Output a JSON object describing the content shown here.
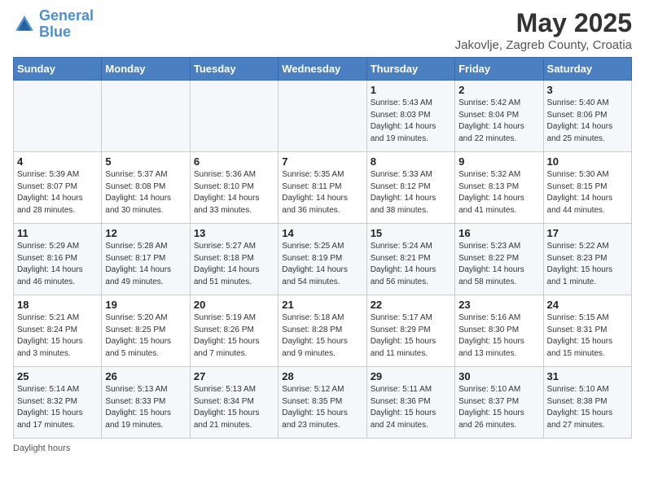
{
  "header": {
    "logo_line1": "General",
    "logo_line2": "Blue",
    "title": "May 2025",
    "subtitle": "Jakovlje, Zagreb County, Croatia"
  },
  "days_of_week": [
    "Sunday",
    "Monday",
    "Tuesday",
    "Wednesday",
    "Thursday",
    "Friday",
    "Saturday"
  ],
  "weeks": [
    [
      {
        "day": "",
        "detail": ""
      },
      {
        "day": "",
        "detail": ""
      },
      {
        "day": "",
        "detail": ""
      },
      {
        "day": "",
        "detail": ""
      },
      {
        "day": "1",
        "detail": "Sunrise: 5:43 AM\nSunset: 8:03 PM\nDaylight: 14 hours\nand 19 minutes."
      },
      {
        "day": "2",
        "detail": "Sunrise: 5:42 AM\nSunset: 8:04 PM\nDaylight: 14 hours\nand 22 minutes."
      },
      {
        "day": "3",
        "detail": "Sunrise: 5:40 AM\nSunset: 8:06 PM\nDaylight: 14 hours\nand 25 minutes."
      }
    ],
    [
      {
        "day": "4",
        "detail": "Sunrise: 5:39 AM\nSunset: 8:07 PM\nDaylight: 14 hours\nand 28 minutes."
      },
      {
        "day": "5",
        "detail": "Sunrise: 5:37 AM\nSunset: 8:08 PM\nDaylight: 14 hours\nand 30 minutes."
      },
      {
        "day": "6",
        "detail": "Sunrise: 5:36 AM\nSunset: 8:10 PM\nDaylight: 14 hours\nand 33 minutes."
      },
      {
        "day": "7",
        "detail": "Sunrise: 5:35 AM\nSunset: 8:11 PM\nDaylight: 14 hours\nand 36 minutes."
      },
      {
        "day": "8",
        "detail": "Sunrise: 5:33 AM\nSunset: 8:12 PM\nDaylight: 14 hours\nand 38 minutes."
      },
      {
        "day": "9",
        "detail": "Sunrise: 5:32 AM\nSunset: 8:13 PM\nDaylight: 14 hours\nand 41 minutes."
      },
      {
        "day": "10",
        "detail": "Sunrise: 5:30 AM\nSunset: 8:15 PM\nDaylight: 14 hours\nand 44 minutes."
      }
    ],
    [
      {
        "day": "11",
        "detail": "Sunrise: 5:29 AM\nSunset: 8:16 PM\nDaylight: 14 hours\nand 46 minutes."
      },
      {
        "day": "12",
        "detail": "Sunrise: 5:28 AM\nSunset: 8:17 PM\nDaylight: 14 hours\nand 49 minutes."
      },
      {
        "day": "13",
        "detail": "Sunrise: 5:27 AM\nSunset: 8:18 PM\nDaylight: 14 hours\nand 51 minutes."
      },
      {
        "day": "14",
        "detail": "Sunrise: 5:25 AM\nSunset: 8:19 PM\nDaylight: 14 hours\nand 54 minutes."
      },
      {
        "day": "15",
        "detail": "Sunrise: 5:24 AM\nSunset: 8:21 PM\nDaylight: 14 hours\nand 56 minutes."
      },
      {
        "day": "16",
        "detail": "Sunrise: 5:23 AM\nSunset: 8:22 PM\nDaylight: 14 hours\nand 58 minutes."
      },
      {
        "day": "17",
        "detail": "Sunrise: 5:22 AM\nSunset: 8:23 PM\nDaylight: 15 hours\nand 1 minute."
      }
    ],
    [
      {
        "day": "18",
        "detail": "Sunrise: 5:21 AM\nSunset: 8:24 PM\nDaylight: 15 hours\nand 3 minutes."
      },
      {
        "day": "19",
        "detail": "Sunrise: 5:20 AM\nSunset: 8:25 PM\nDaylight: 15 hours\nand 5 minutes."
      },
      {
        "day": "20",
        "detail": "Sunrise: 5:19 AM\nSunset: 8:26 PM\nDaylight: 15 hours\nand 7 minutes."
      },
      {
        "day": "21",
        "detail": "Sunrise: 5:18 AM\nSunset: 8:28 PM\nDaylight: 15 hours\nand 9 minutes."
      },
      {
        "day": "22",
        "detail": "Sunrise: 5:17 AM\nSunset: 8:29 PM\nDaylight: 15 hours\nand 11 minutes."
      },
      {
        "day": "23",
        "detail": "Sunrise: 5:16 AM\nSunset: 8:30 PM\nDaylight: 15 hours\nand 13 minutes."
      },
      {
        "day": "24",
        "detail": "Sunrise: 5:15 AM\nSunset: 8:31 PM\nDaylight: 15 hours\nand 15 minutes."
      }
    ],
    [
      {
        "day": "25",
        "detail": "Sunrise: 5:14 AM\nSunset: 8:32 PM\nDaylight: 15 hours\nand 17 minutes."
      },
      {
        "day": "26",
        "detail": "Sunrise: 5:13 AM\nSunset: 8:33 PM\nDaylight: 15 hours\nand 19 minutes."
      },
      {
        "day": "27",
        "detail": "Sunrise: 5:13 AM\nSunset: 8:34 PM\nDaylight: 15 hours\nand 21 minutes."
      },
      {
        "day": "28",
        "detail": "Sunrise: 5:12 AM\nSunset: 8:35 PM\nDaylight: 15 hours\nand 23 minutes."
      },
      {
        "day": "29",
        "detail": "Sunrise: 5:11 AM\nSunset: 8:36 PM\nDaylight: 15 hours\nand 24 minutes."
      },
      {
        "day": "30",
        "detail": "Sunrise: 5:10 AM\nSunset: 8:37 PM\nDaylight: 15 hours\nand 26 minutes."
      },
      {
        "day": "31",
        "detail": "Sunrise: 5:10 AM\nSunset: 8:38 PM\nDaylight: 15 hours\nand 27 minutes."
      }
    ]
  ],
  "footer": {
    "note": "Daylight hours"
  }
}
